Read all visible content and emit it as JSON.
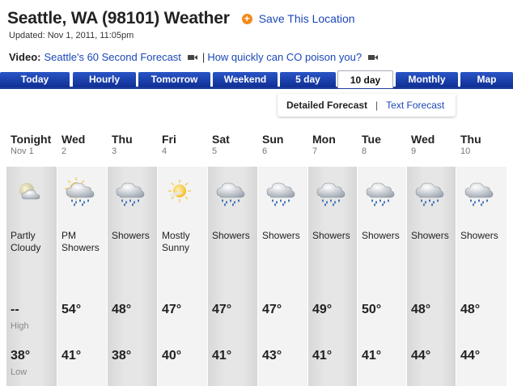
{
  "header": {
    "title": "Seattle, WA (98101) Weather",
    "save_label": "Save This Location",
    "updated": "Updated: Nov 1, 2011, 11:05pm"
  },
  "video": {
    "label": "Video:",
    "link1": "Seattle's 60 Second Forecast",
    "separator": "|",
    "link2": "How quickly can CO poison you?"
  },
  "tabs": [
    {
      "label": "Today"
    },
    {
      "label": "Hourly"
    },
    {
      "label": "Tomorrow"
    },
    {
      "label": "Weekend"
    },
    {
      "label": "5 day"
    },
    {
      "label": "10 day"
    },
    {
      "label": "Monthly"
    },
    {
      "label": "Map"
    }
  ],
  "active_tab": "10 day",
  "subtabs": {
    "detailed": "Detailed Forecast",
    "separator": "|",
    "text": "Text Forecast"
  },
  "labels": {
    "high": "High",
    "low": "Low"
  },
  "days": [
    {
      "name": "Tonight",
      "date": "Nov 1",
      "icon": "partly-cloudy-night-icon",
      "condition": [
        "Partly",
        "Cloudy"
      ],
      "high": "--",
      "low": "38°"
    },
    {
      "name": "Wed",
      "date": "2",
      "icon": "pm-showers-icon",
      "condition": [
        "PM",
        "Showers"
      ],
      "high": "54°",
      "low": "41°"
    },
    {
      "name": "Thu",
      "date": "3",
      "icon": "showers-icon",
      "condition": [
        "Showers"
      ],
      "high": "48°",
      "low": "38°"
    },
    {
      "name": "Fri",
      "date": "4",
      "icon": "mostly-sunny-icon",
      "condition": [
        "Mostly",
        "Sunny"
      ],
      "high": "47°",
      "low": "40°"
    },
    {
      "name": "Sat",
      "date": "5",
      "icon": "showers-icon",
      "condition": [
        "Showers"
      ],
      "high": "47°",
      "low": "41°"
    },
    {
      "name": "Sun",
      "date": "6",
      "icon": "showers-icon",
      "condition": [
        "Showers"
      ],
      "high": "47°",
      "low": "43°"
    },
    {
      "name": "Mon",
      "date": "7",
      "icon": "showers-icon",
      "condition": [
        "Showers"
      ],
      "high": "49°",
      "low": "41°"
    },
    {
      "name": "Tue",
      "date": "8",
      "icon": "showers-icon",
      "condition": [
        "Showers"
      ],
      "high": "50°",
      "low": "41°"
    },
    {
      "name": "Wed",
      "date": "9",
      "icon": "showers-icon",
      "condition": [
        "Showers"
      ],
      "high": "48°",
      "low": "44°"
    },
    {
      "name": "Thu",
      "date": "10",
      "icon": "showers-icon",
      "condition": [
        "Showers"
      ],
      "high": "48°",
      "low": "44°"
    }
  ],
  "colors": {
    "link": "#1a47b8",
    "tab_bg": "#1e3f9a",
    "plus_icon": "#f28a1c"
  }
}
